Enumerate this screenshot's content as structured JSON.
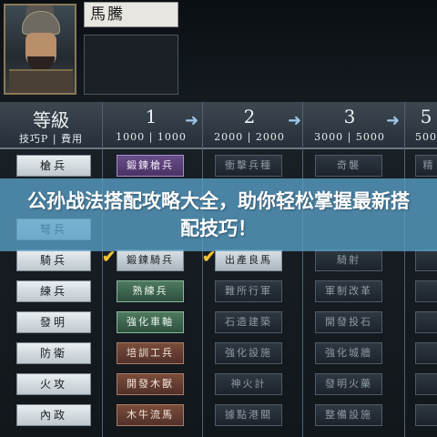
{
  "character": {
    "name": "馬騰"
  },
  "header": {
    "level_title": "等級",
    "level_sub": "技巧P | 費用",
    "columns": [
      {
        "level": "1",
        "cost": "1000 | 1000"
      },
      {
        "level": "2",
        "cost": "2000 | 2000"
      },
      {
        "level": "3",
        "cost": "3000 | 5000"
      },
      {
        "level": "5",
        "cost": "500"
      }
    ],
    "arrow": "➜"
  },
  "rows": [
    {
      "name": "槍兵",
      "skills": [
        "鍛鍊槍兵",
        "衝擊兵種",
        "奇襲",
        "精"
      ]
    },
    {
      "name": "弩兵",
      "skills": [
        "",
        "",
        "",
        ""
      ]
    },
    {
      "name": "騎兵",
      "skills": [
        "鍛鍊騎兵",
        "出產良馬",
        "騎射",
        ""
      ]
    },
    {
      "name": "練兵",
      "skills": [
        "熟練兵",
        "難所行軍",
        "軍制改革",
        ""
      ]
    },
    {
      "name": "發明",
      "skills": [
        "強化車軸",
        "石造建築",
        "開發投石",
        ""
      ]
    },
    {
      "name": "防衛",
      "skills": [
        "培訓工兵",
        "強化設施",
        "強化城牆",
        ""
      ]
    },
    {
      "name": "火攻",
      "skills": [
        "開發木獸",
        "神火計",
        "發明火藥",
        ""
      ]
    },
    {
      "name": "內政",
      "skills": [
        "木牛流馬",
        "據點港關",
        "整備設施",
        ""
      ]
    }
  ],
  "banner": {
    "text": "公孙战法搭配攻略大全，助你轻松掌握最新搭配技巧！"
  },
  "check_mark": "✔"
}
